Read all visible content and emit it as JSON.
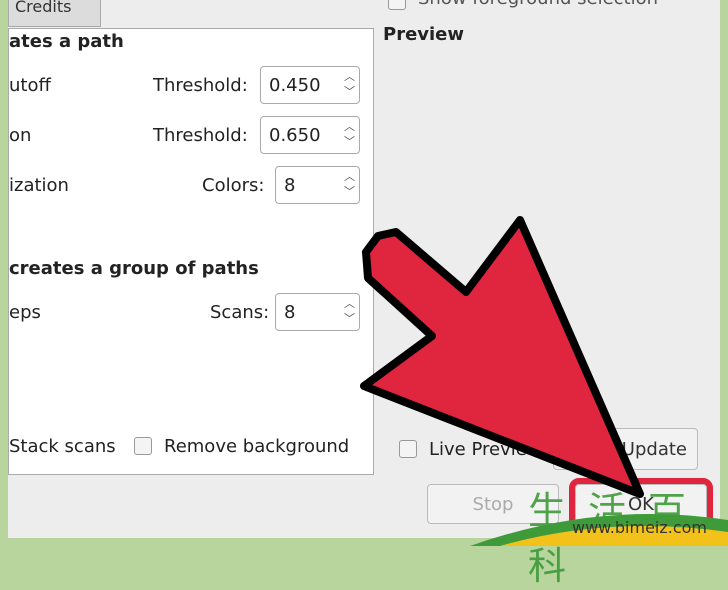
{
  "tab": {
    "label": "Credits"
  },
  "top_checkbox_label": "Show foreground selection",
  "preview": {
    "title": "Preview",
    "live_preview": "Live Preview",
    "update": "Update"
  },
  "single_scan": {
    "heading": "ates a path",
    "rows": [
      {
        "label": "utoff",
        "field": "Threshold:",
        "value": "0.450"
      },
      {
        "label": "on",
        "field": "Threshold:",
        "value": "0.650"
      },
      {
        "label": "ization",
        "field": "Colors:",
        "value": "8"
      }
    ]
  },
  "multi_scan": {
    "heading": "creates a group of paths",
    "rows": [
      {
        "label": "eps",
        "field": "Scans:",
        "value": "8"
      }
    ]
  },
  "options": {
    "stack_scans": "Stack scans",
    "remove_background": "Remove background"
  },
  "buttons": {
    "stop": "Stop",
    "ok": "OK"
  },
  "watermark": {
    "cn": "生活百科",
    "url": "www.bimeiz.com"
  },
  "colors": {
    "arrow": "#e0253f",
    "frame": "#b7d59c"
  }
}
